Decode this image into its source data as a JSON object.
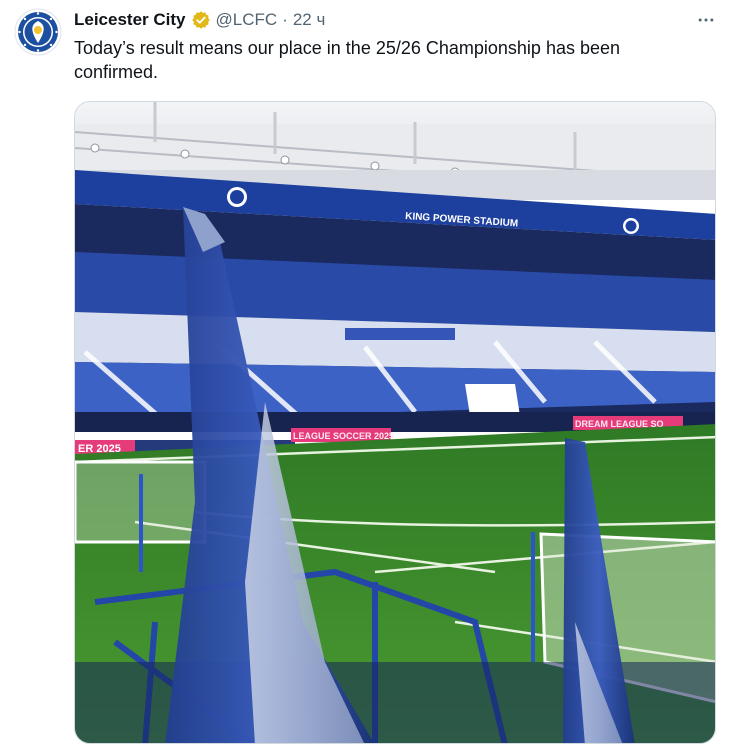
{
  "tweet": {
    "display_name": "Leicester City",
    "handle": "@LCFC",
    "separator": "·",
    "time": "22 ч",
    "text": "Today’s result means our place in the 25/26 Championship has been confirmed.",
    "verified_badge": "gold-verified-badge-icon",
    "more_icon": "more-horizontal-icon"
  },
  "media": {
    "stadium_sign": "KING POWER STADIUM",
    "left_stand_board": "ER 2025",
    "right_board": "DREAM LEAGUE SO",
    "center_board": "LEAGUE SOCCER 2025"
  },
  "colors": {
    "brand_blue": "#1d3f9e",
    "pitch_green": "#3f8c2c",
    "gold_badge": "#e2b719",
    "text_secondary": "#536471"
  }
}
